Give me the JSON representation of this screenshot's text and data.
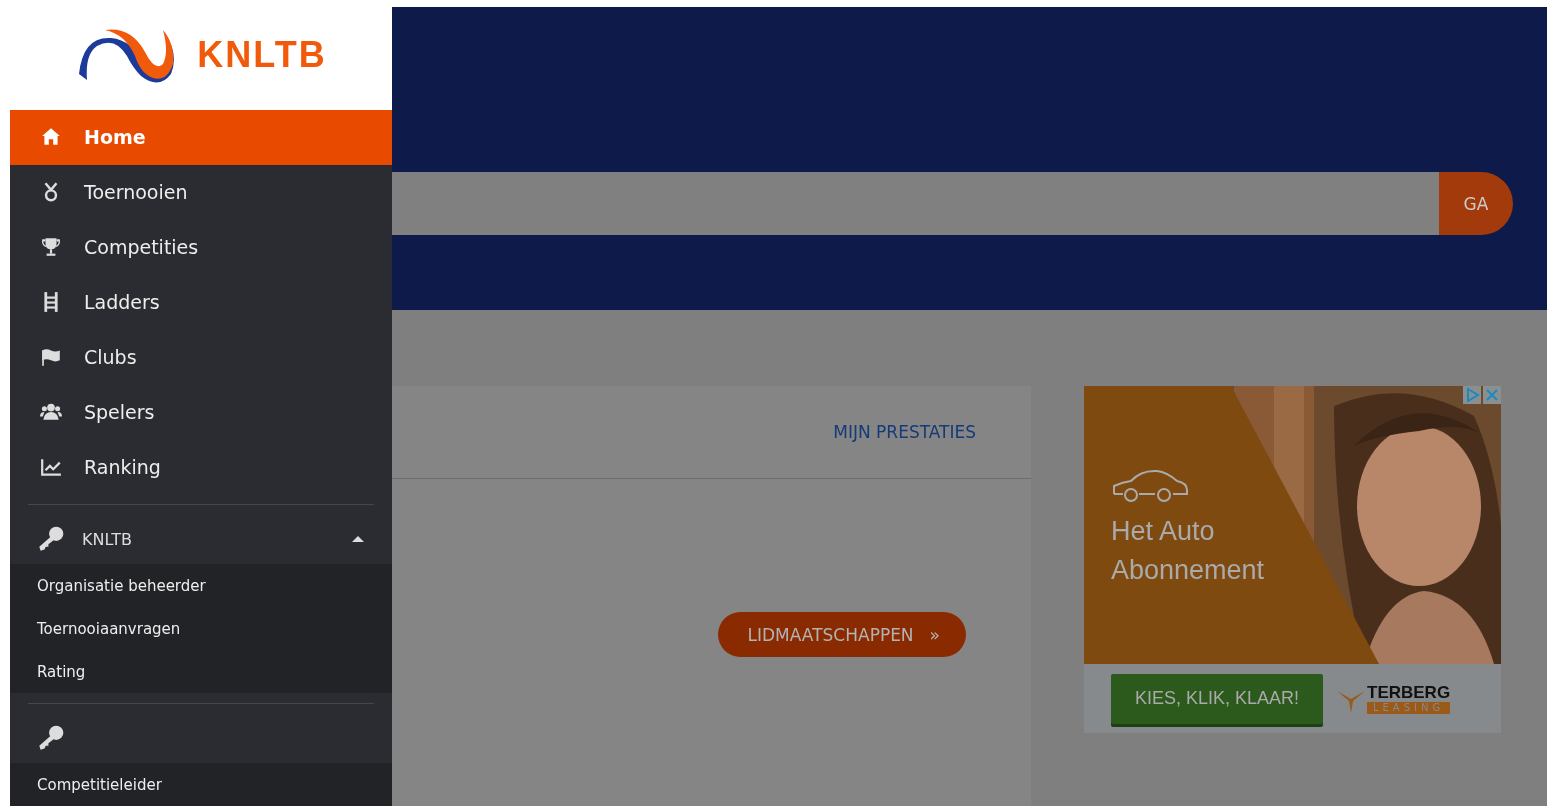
{
  "logo": {
    "text": "KNLTB"
  },
  "nav": [
    {
      "label": "Home",
      "selected": true
    },
    {
      "label": "Toernooien",
      "selected": false
    },
    {
      "label": "Competities",
      "selected": false
    },
    {
      "label": "Ladders",
      "selected": false
    },
    {
      "label": "Clubs",
      "selected": false
    },
    {
      "label": "Spelers",
      "selected": false
    },
    {
      "label": "Ranking",
      "selected": false
    }
  ],
  "sections": [
    {
      "title": "KNLTB",
      "expanded": true,
      "items": [
        "Organisatie beheerder",
        "Toernooiaanvragen",
        "Rating"
      ]
    },
    {
      "items": [
        "Competitieleider"
      ]
    }
  ],
  "search": {
    "button": "GA"
  },
  "card": {
    "link": "MIJN PRESTATIES",
    "button": "LIDMAATSCHAPPEN",
    "button_icon": "»"
  },
  "ad": {
    "headline": "Het Auto Abonnement",
    "cta": "KIES, KLIK, KLAAR!",
    "brand": "TERBERG",
    "brand_sub": "LEASING"
  }
}
